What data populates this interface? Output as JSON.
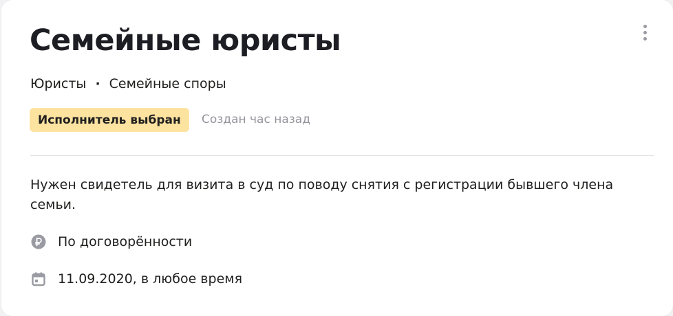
{
  "task": {
    "title": "Семейные юристы",
    "breadcrumbs": [
      "Юристы",
      "Семейные споры"
    ],
    "breadcrumb_separator": "·",
    "status_badge": "Исполнитель выбран",
    "created": "Создан час назад",
    "description": "Нужен свидетель для визита в суд по поводу снятия с регистрации бывшего члена семьи.",
    "price": "По договорённости",
    "date": "11.09.2020, в любое время"
  },
  "icons": {
    "more": "more-vertical-icon",
    "price": "ruble-icon",
    "date": "calendar-icon"
  },
  "colors": {
    "badge_background": "#fde3a0",
    "muted_text": "#93939b",
    "icon_gray": "#9a9aa2"
  }
}
